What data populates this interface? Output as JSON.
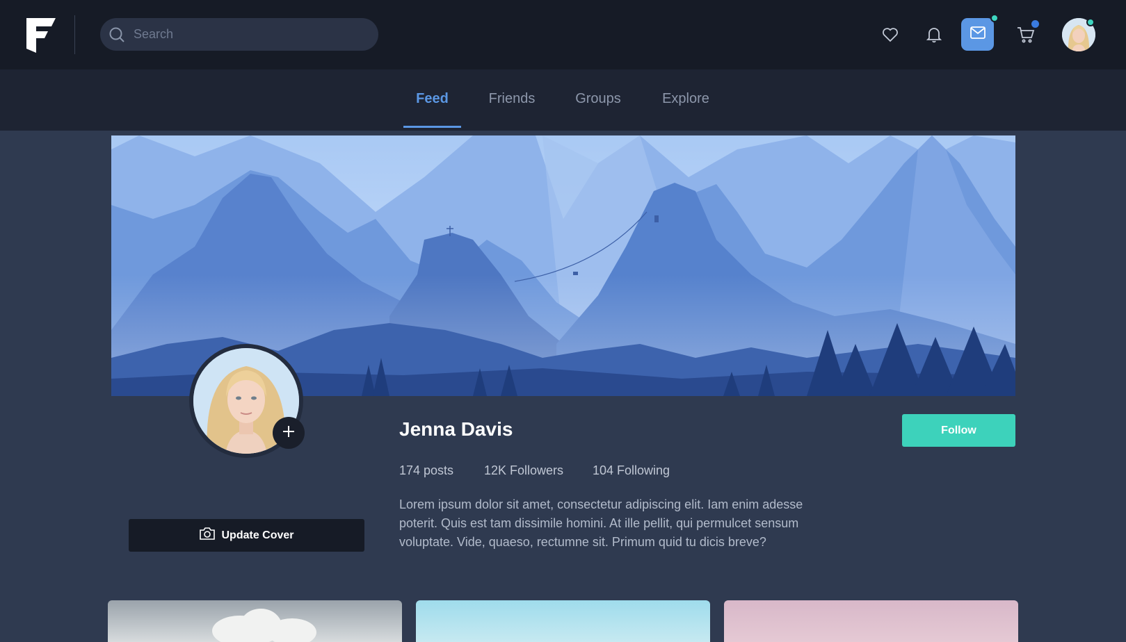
{
  "header": {
    "search": {
      "placeholder": "Search",
      "value": ""
    },
    "icons": [
      "logo-icon",
      "search-icon",
      "heart-icon",
      "bell-icon",
      "mail-icon",
      "cart-icon",
      "avatar"
    ],
    "accent_color": "#5b97e4",
    "notification_color": "#3ed6c0"
  },
  "tabs": [
    {
      "label": "Feed",
      "active": true
    },
    {
      "label": "Friends",
      "active": false
    },
    {
      "label": "Groups",
      "active": false
    },
    {
      "label": "Explore",
      "active": false
    }
  ],
  "profile": {
    "name": "Jenna Davis",
    "stats": {
      "posts": "174 posts",
      "followers": "12K Followers",
      "following": "104 Following"
    },
    "bio": "Lorem ipsum dolor sit amet, consectetur adipiscing elit. Iam enim adesse poterit. Quis est tam dissimile homini. At ille pellit, qui permulcet sensum voluptate. Vide, quaeso, rectumne sit. Primum quid tu dicis breve?",
    "follow_label": "Follow",
    "update_cover_label": "Update Cover",
    "follow_color": "#3dd2bb"
  }
}
